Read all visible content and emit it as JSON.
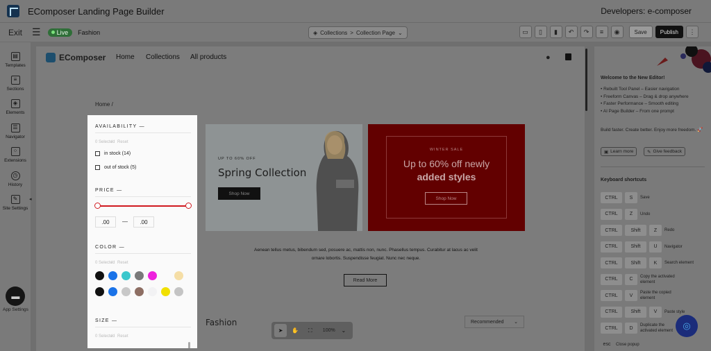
{
  "app": {
    "title": "EComposer Landing Page Builder",
    "developers": "Developers: e-composer"
  },
  "toolbar": {
    "exit": "Exit",
    "live": "Live",
    "page_name": "Fashion",
    "crumb1": "Collections",
    "crumb_sep": ">",
    "crumb2": "Collection Page",
    "zoom": "100%",
    "save": "Save",
    "publish": "Publish"
  },
  "sidebar": {
    "items": [
      {
        "label": "Templates"
      },
      {
        "label": "Sections"
      },
      {
        "label": "Elements"
      },
      {
        "label": "Navigator"
      },
      {
        "label": "Extensions"
      },
      {
        "label": "History"
      },
      {
        "label": "Site Settings"
      }
    ],
    "app_settings": "App Settings"
  },
  "store": {
    "brand": "EComposer",
    "nav": [
      "Home",
      "Collections",
      "All products"
    ],
    "breadcrumb": "Home /"
  },
  "filter": {
    "availability": {
      "title": "AVAILABILITY —",
      "selected": "0 Selected",
      "reset": "Reset",
      "options": [
        "in stock (14)",
        "out of stock (5)"
      ]
    },
    "price": {
      "title": "PRICE —",
      "min": ".00",
      "max": ".00",
      "dash": "—"
    },
    "color": {
      "title": "COLOR —",
      "selected": "0 Selected",
      "reset": "Reset",
      "swatches": [
        "#111111",
        "#1a73e8",
        "#3cc7cc",
        "#7a7a7a",
        "#ee22dd",
        "#fafafa",
        "#f5dea6",
        "#111111",
        "#1a73e8",
        "#c8c8c8",
        "#8d6e63",
        "#f2f2f4",
        "#f1e000",
        "#c4c4c4"
      ]
    },
    "size": {
      "title": "SIZE —",
      "selected": "0 Selected",
      "reset": "Reset"
    },
    "slash": "/"
  },
  "banner1": {
    "tag": "UP TO 60% OFF",
    "title": "Spring Collection",
    "button": "Shop Now"
  },
  "banner2": {
    "tag": "WINTER SALE",
    "line1": "Up to 60% off newly",
    "line2": "added styles",
    "button": "Shop Now"
  },
  "description": "Aenean tellus metus, bibendum sed, posuere ac, mattis non, nunc. Phasellus tempus. Curabitur at lacus ac velit ornare lobortis. Suspendisse feugiat. Nunc nec neque.",
  "read_more": "Read More",
  "fashion_heading": "Fashion",
  "sort": "Recommended",
  "right_panel": {
    "welcome": "Welcome to the New Editor!",
    "features": [
      "Rebuilt Tool Panel – Easier navigation",
      "Freeform Canvas – Drag & drop anywhere",
      "Faster Performance – Smooth editing",
      "AI Page Builder – From one prompt"
    ],
    "tagline": "Build faster. Create better. Enjoy more freedom. 🚀",
    "learn_more": "Learn more",
    "give_feedback": "Give feedback",
    "shortcuts_title": "Keyboard shortcuts",
    "shortcuts": [
      {
        "keys": [
          "CTRL",
          "S"
        ],
        "action": "Save"
      },
      {
        "keys": [
          "CTRL",
          "Z"
        ],
        "action": "Undo"
      },
      {
        "keys": [
          "CTRL",
          "Shift",
          "Z"
        ],
        "action": "Redo"
      },
      {
        "keys": [
          "CTRL",
          "Shift",
          "U"
        ],
        "action": "Navigator"
      },
      {
        "keys": [
          "CTRL",
          "Shift",
          "K"
        ],
        "action": "Search element"
      },
      {
        "keys": [
          "CTRL",
          "C"
        ],
        "action": "Copy the activated element"
      },
      {
        "keys": [
          "CTRL",
          "V"
        ],
        "action": "Paste the copied element"
      },
      {
        "keys": [
          "CTRL",
          "Shift",
          "V"
        ],
        "action": "Paste style"
      },
      {
        "keys": [
          "CTRL",
          "D"
        ],
        "action": "Duplicate the activated element"
      },
      {
        "keys": [
          "esc"
        ],
        "action": "Close popup"
      }
    ]
  }
}
